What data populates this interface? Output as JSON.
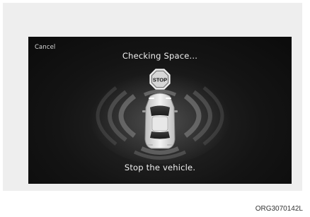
{
  "screen": {
    "cancel_label": "Cancel",
    "title": "Checking Space...",
    "message": "Stop the vehicle.",
    "stop_sign_label": "STOP"
  },
  "figure_code": "ORG3070142L",
  "colors": {
    "screen_background": "#111111",
    "text": "#f0f0f0",
    "stop_sign": "#cfcfcf",
    "sensor_arcs": "#9a9a9a"
  },
  "icons": [
    "stop-sign-icon",
    "vehicle-icon",
    "sensor-arcs"
  ]
}
